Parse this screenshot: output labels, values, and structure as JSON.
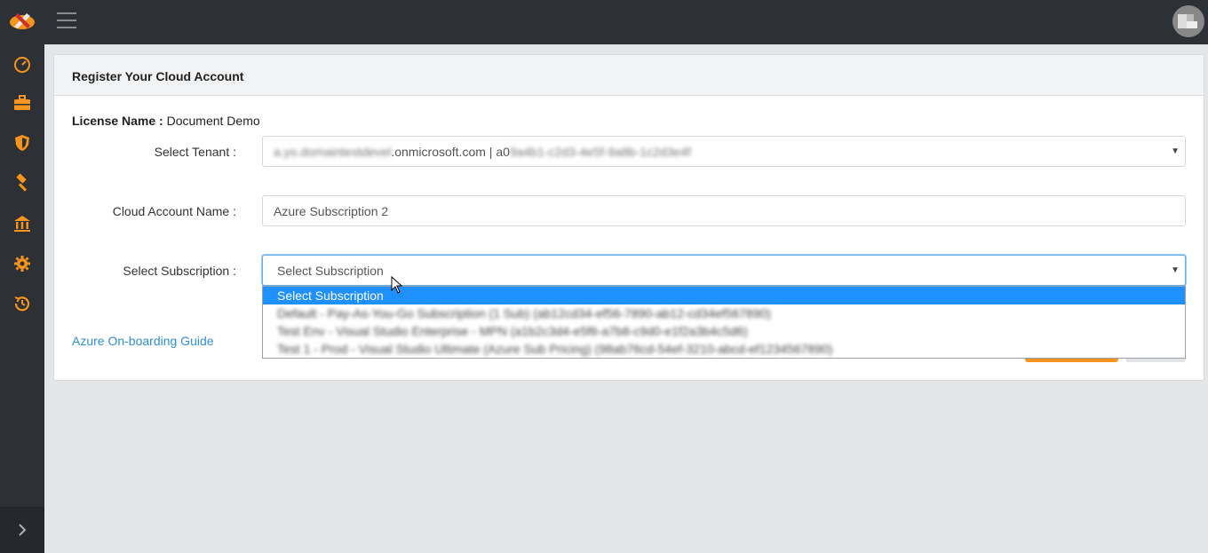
{
  "app": {
    "brand_logo": "cloud-tools-logo",
    "menu_icon": "hamburger-icon",
    "avatar": "user-avatar"
  },
  "sidebar": {
    "items": [
      {
        "icon": "speedometer-icon"
      },
      {
        "icon": "briefcase-icon"
      },
      {
        "icon": "shield-icon"
      },
      {
        "icon": "hammer-icon"
      },
      {
        "icon": "bank-icon"
      },
      {
        "icon": "gear-icon"
      },
      {
        "icon": "history-icon"
      }
    ],
    "toggle_icon": "chevron-right-icon",
    "accent": "#f7941d"
  },
  "card": {
    "title": "Register Your Cloud Account"
  },
  "form": {
    "license_label": "License Name :",
    "license_value": "Document Demo",
    "tenant_label": "Select Tenant :",
    "tenant_prefix": "a.yo.domaintestdevel",
    "tenant_domain": ".onmicrosoft.com | a0",
    "tenant_suffix": "9a4b1-c2d3-4e5f-9a8b-1c2d3e4f",
    "cloud_account_label": "Cloud Account Name :",
    "cloud_account_value": "Azure Subscription 2",
    "subscription_label": "Select Subscription :",
    "subscription_value": "Select Subscription",
    "subscription_options": [
      "Select Subscription",
      "Default - Pay-As-You-Go Subscription (1 Sub) (ab12cd34-ef56-7890-ab12-cd34ef567890)",
      "Test Env - Visual Studio Enterprise - MPN (a1b2c3d4-e5f6-a7b8-c9d0-e1f2a3b4c5d6)",
      "Test 1 - Prod - Visual Studio Ultimate (Azure Sub Pricing) (98ab76cd-54ef-3210-abcd-ef1234567890)"
    ],
    "guide_link": "Azure On-boarding Guide"
  }
}
